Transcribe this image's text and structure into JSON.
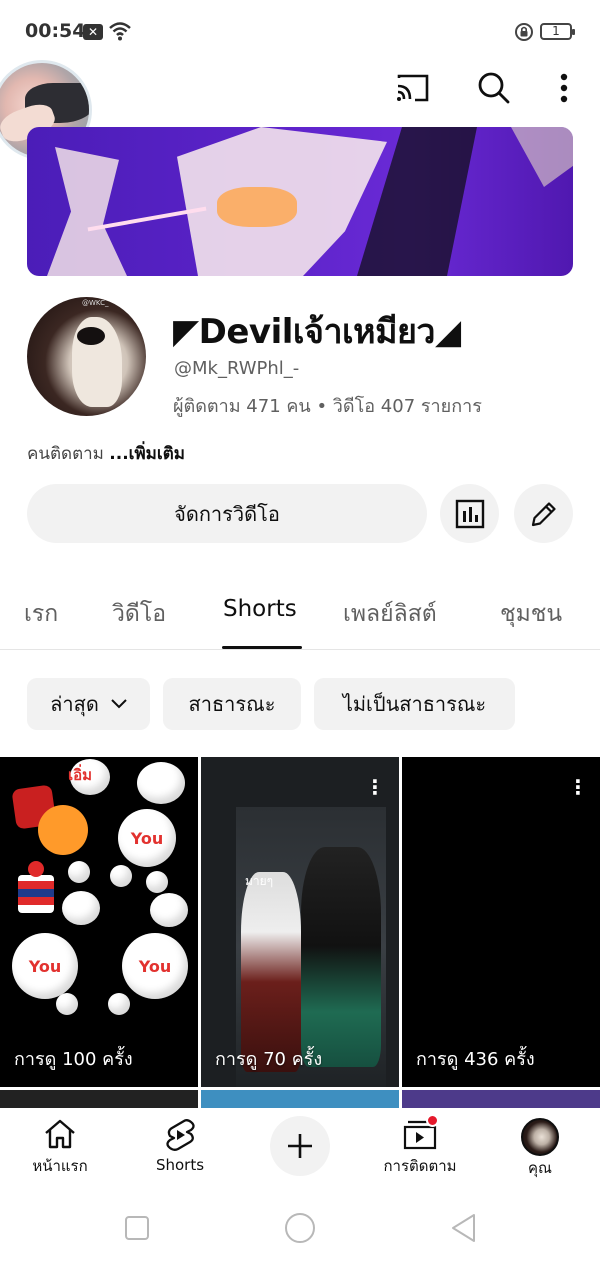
{
  "status_bar": {
    "time": "00:54",
    "notification_badge": "✕",
    "battery_level": "1"
  },
  "channel": {
    "name": "◤Devilเจ้าเหมียว◢",
    "handle": "@Mk_RWPhl_-",
    "stats": "ผู้ติดตาม 471 คน • วิดีโอ 407 รายการ",
    "description_prefix": "คนติดตาม ",
    "description_more": "...เพิ่มเติม",
    "avatar_tag": "@WKC_"
  },
  "actions": {
    "manage_videos": "จัดการวิดีโอ"
  },
  "tabs": [
    {
      "label": "เรก"
    },
    {
      "label": "วิดีโอ"
    },
    {
      "label": "Shorts"
    },
    {
      "label": "เพลย์ลิสต์"
    },
    {
      "label": "ชุมชน"
    }
  ],
  "active_tab": "Shorts",
  "filter_chips": {
    "sort": "ล่าสุด",
    "public": "สาธารณะ",
    "private": "ไม่เป็นสาธารณะ"
  },
  "shorts": [
    {
      "views": "การดู 100 ครั้ง",
      "overlay": "เอิ่ม",
      "bubble_text": "You"
    },
    {
      "views": "การดู 70 ครั้ง",
      "overlay": "มายๆ"
    },
    {
      "views": "การดู 436 ครั้ง"
    }
  ],
  "bottom_nav": {
    "home": "หน้าแรก",
    "shorts": "Shorts",
    "subscriptions": "การติดตาม",
    "you": "คุณ"
  },
  "colors": {
    "accent_red": "#e5192c",
    "chip_bg": "#f2f2f2",
    "banner_purple": "#5a22c7"
  },
  "icons": [
    "cast-icon",
    "search-icon",
    "more-vert-icon",
    "analytics-icon",
    "edit-icon",
    "home-icon",
    "shorts-icon",
    "plus-icon",
    "subscriptions-icon"
  ]
}
